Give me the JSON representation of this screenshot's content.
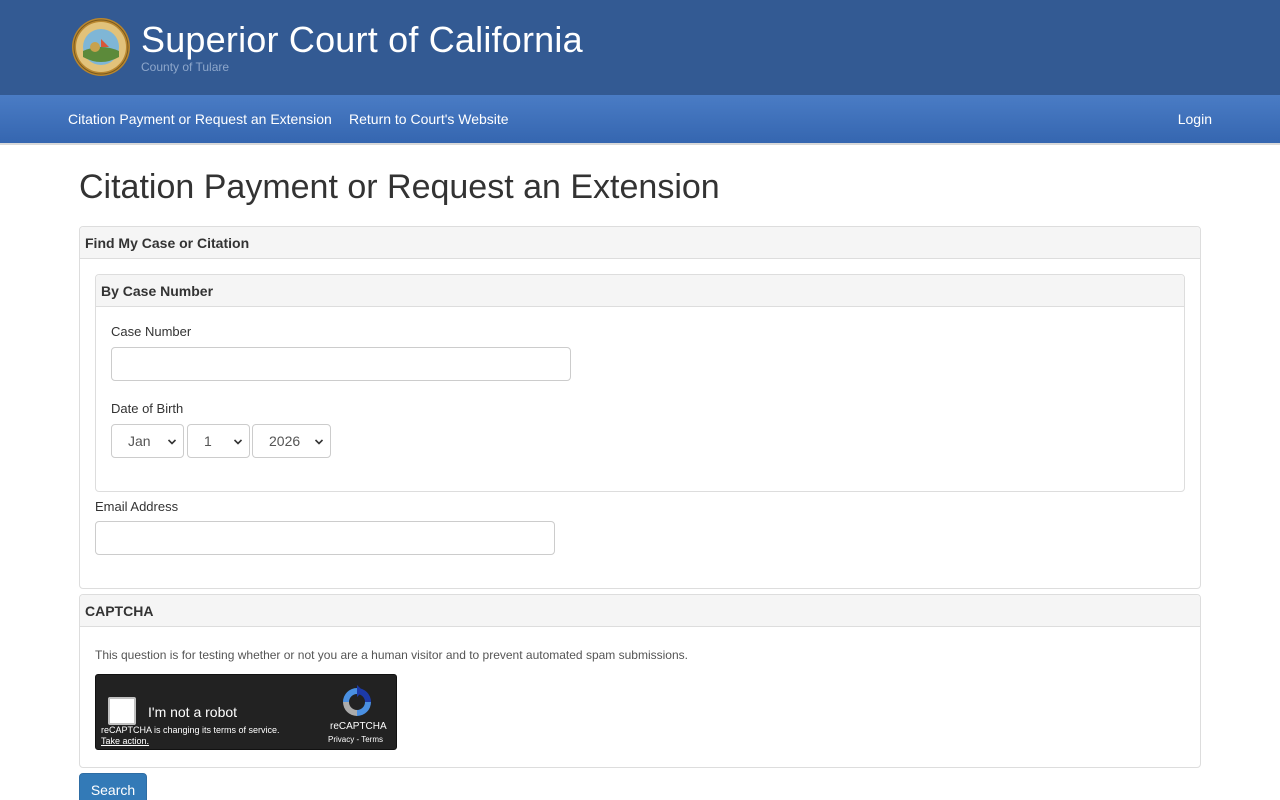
{
  "header": {
    "title": "Superior Court of California",
    "subtitle": "County of Tulare"
  },
  "nav": {
    "items": [
      "Citation Payment or Request an Extension",
      "Return to Court's Website"
    ],
    "login": "Login"
  },
  "page": {
    "title": "Citation Payment or Request an Extension"
  },
  "find_panel": {
    "heading": "Find My Case or Citation",
    "by_case": {
      "heading": "By Case Number",
      "case_number_label": "Case Number",
      "case_number_value": "",
      "dob_label": "Date of Birth",
      "dob_month": "Jan",
      "dob_day": "1",
      "dob_year": "2026"
    },
    "email_label": "Email Address",
    "email_value": ""
  },
  "captcha_panel": {
    "heading": "CAPTCHA",
    "note": "This question is for testing whether or not you are a human visitor and to prevent automated spam submissions.",
    "recaptcha": {
      "label": "I'm not a robot",
      "notice": "reCAPTCHA is changing its terms of service.",
      "action": "Take action.",
      "brand": "reCAPTCHA",
      "privacy": "Privacy",
      "separator": " - ",
      "terms": "Terms"
    }
  },
  "search_label": "Search",
  "colors": {
    "header_bg": "#335a93",
    "nav_bg": "#3f70bb",
    "primary_button": "#337ab7"
  }
}
